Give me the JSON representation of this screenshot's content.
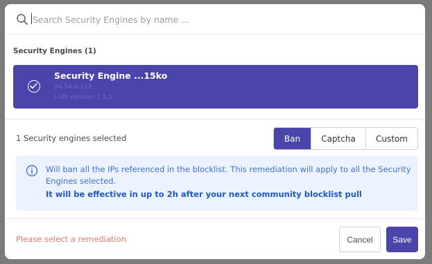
{
  "search": {
    "placeholder": "Search Security Engines by name ...",
    "value": ""
  },
  "section": {
    "label": "Security Engines (1)"
  },
  "engine": {
    "name": "Security Engine ...15ko",
    "ip": "94.54.4.111",
    "lapi": "LAPI version: 1.5.5",
    "selected": true
  },
  "selection": {
    "count_text": "1 Security engines selected"
  },
  "remediation": {
    "options": [
      "Ban",
      "Captcha",
      "Custom"
    ],
    "active": "Ban"
  },
  "info": {
    "text": "Will ban all the IPs referenced in the blocklist. This remediation will apply to all the Security Engines selected.",
    "bold_text": "It will be effective in up to 2h after your next community blocklist pull"
  },
  "footer": {
    "error": "Please select a remediation",
    "cancel_label": "Cancel",
    "save_label": "Save"
  },
  "colors": {
    "accent": "#4b44aa",
    "info_bg": "#ecf3fe",
    "info_text": "#3e6fd1",
    "error": "#e6786f"
  },
  "icons": {
    "search": "search-icon",
    "check": "check-circle-icon",
    "info": "info-icon"
  }
}
